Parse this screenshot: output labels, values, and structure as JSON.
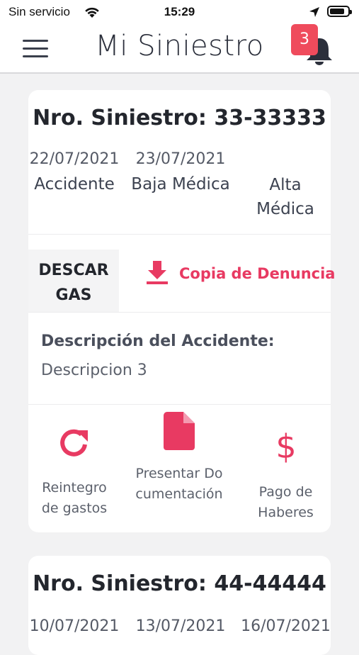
{
  "status_bar": {
    "carrier": "Sin servicio",
    "time": "15:29"
  },
  "header": {
    "title": "Mi Siniestro",
    "notification_count": "3"
  },
  "claims": [
    {
      "title": "Nro. Siniestro: 33-33333",
      "dates": [
        {
          "date": "22/07/2021",
          "label": "Accidente"
        },
        {
          "date": "23/07/2021",
          "label": "Baja Médica"
        },
        {
          "date": "",
          "label": "Alta Médica"
        }
      ],
      "downloads_label": "DESCARGAS",
      "download_link": "Copia de Denuncia",
      "description_title": "Descripción del Accidente:",
      "description_text": "Descripcion 3",
      "actions": [
        {
          "label": "Reintegro de gastos"
        },
        {
          "label": "Presentar Documentación"
        },
        {
          "label": "Pago de Haberes"
        }
      ]
    },
    {
      "title": "Nro. Siniestro: 44-44444",
      "dates": [
        {
          "date": "10/07/2021"
        },
        {
          "date": "13/07/2021"
        },
        {
          "date": "16/07/2021"
        }
      ]
    }
  ],
  "colors": {
    "accent": "#E83A62",
    "badge": "#EF4B5C",
    "background": "#F2F2F3"
  }
}
